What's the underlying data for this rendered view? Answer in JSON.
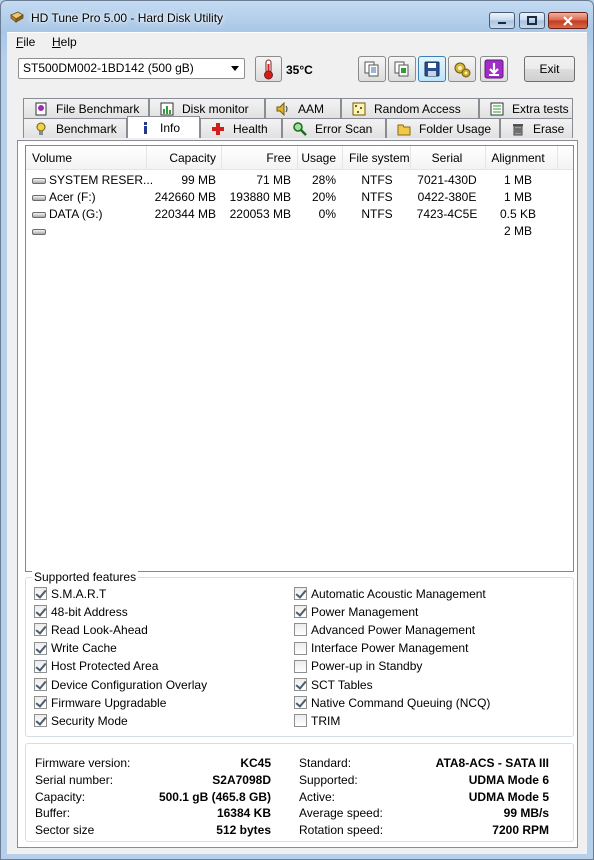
{
  "window": {
    "title": "HD Tune Pro 5.00 - Hard Disk Utility"
  },
  "menu": {
    "file": "File",
    "help": "Help",
    "file_key": "F",
    "file_rest": "ile",
    "help_key": "H",
    "help_rest": "elp"
  },
  "toolbar": {
    "drive": "ST500DM002-1BD142 (500 gB)",
    "temperature": "35",
    "temperature_unit": "°C",
    "exit_label": "Exit"
  },
  "tabs_top": [
    {
      "label": "File Benchmark"
    },
    {
      "label": "Disk monitor"
    },
    {
      "label": "AAM"
    },
    {
      "label": "Random Access"
    },
    {
      "label": "Extra tests"
    }
  ],
  "tabs_bottom": [
    {
      "label": "Benchmark"
    },
    {
      "label": "Info"
    },
    {
      "label": "Health"
    },
    {
      "label": "Error Scan"
    },
    {
      "label": "Folder Usage"
    },
    {
      "label": "Erase"
    }
  ],
  "volumes": {
    "headers": [
      "Volume",
      "Capacity",
      "Free",
      "Usage",
      "File system",
      "Serial",
      "Alignment"
    ],
    "rows": [
      {
        "volume": "SYSTEM RESER...",
        "capacity": "99 MB",
        "free": "71 MB",
        "usage": "28%",
        "fs": "NTFS",
        "serial": "7021-430D",
        "alignment": "1 MB"
      },
      {
        "volume": "Acer (F:)",
        "capacity": "242660 MB",
        "free": "193880 MB",
        "usage": "20%",
        "fs": "NTFS",
        "serial": "0422-380E",
        "alignment": "1 MB"
      },
      {
        "volume": "DATA (G:)",
        "capacity": "220344 MB",
        "free": "220053 MB",
        "usage": "0%",
        "fs": "NTFS",
        "serial": "7423-4C5E",
        "alignment": "0.5 KB"
      },
      {
        "volume": "",
        "capacity": "",
        "free": "",
        "usage": "",
        "fs": "",
        "serial": "",
        "alignment": "2 MB"
      }
    ]
  },
  "features": {
    "title": "Supported features",
    "left": [
      {
        "label": "S.M.A.R.T",
        "checked": true
      },
      {
        "label": "48-bit Address",
        "checked": true
      },
      {
        "label": "Read Look-Ahead",
        "checked": true
      },
      {
        "label": "Write Cache",
        "checked": true
      },
      {
        "label": "Host Protected Area",
        "checked": true
      },
      {
        "label": "Device Configuration Overlay",
        "checked": true
      },
      {
        "label": "Firmware Upgradable",
        "checked": true
      },
      {
        "label": "Security Mode",
        "checked": true
      }
    ],
    "right": [
      {
        "label": "Automatic Acoustic Management",
        "checked": true
      },
      {
        "label": "Power Management",
        "checked": true
      },
      {
        "label": "Advanced Power Management",
        "checked": false
      },
      {
        "label": "Interface Power Management",
        "checked": false
      },
      {
        "label": "Power-up in Standby",
        "checked": false
      },
      {
        "label": "SCT Tables",
        "checked": true
      },
      {
        "label": "Native Command Queuing (NCQ)",
        "checked": true
      },
      {
        "label": "TRIM",
        "checked": false
      }
    ]
  },
  "details": {
    "left": [
      {
        "key": "Firmware version:",
        "value": "KC45"
      },
      {
        "key": "Serial number:",
        "value": "S2A7098D"
      },
      {
        "key": "Capacity:",
        "value": "500.1 gB (465.8 GB)"
      },
      {
        "key": "Buffer:",
        "value": "16384 KB"
      },
      {
        "key": "Sector size",
        "value": "512 bytes"
      }
    ],
    "right": [
      {
        "key": "Standard:",
        "value": "ATA8-ACS - SATA III"
      },
      {
        "key": "Supported:",
        "value": "UDMA Mode 6"
      },
      {
        "key": "Active:",
        "value": "UDMA Mode 5"
      },
      {
        "key": "Average speed:",
        "value": "99 MB/s"
      },
      {
        "key": "Rotation speed:",
        "value": "7200 RPM"
      }
    ]
  },
  "icons": {
    "app": "hdtune-app-icon",
    "thermometer": "thermometer-icon",
    "toolbar": [
      "copy-icon",
      "copy-text-icon",
      "save-icon",
      "options-icon",
      "download-icon"
    ]
  }
}
